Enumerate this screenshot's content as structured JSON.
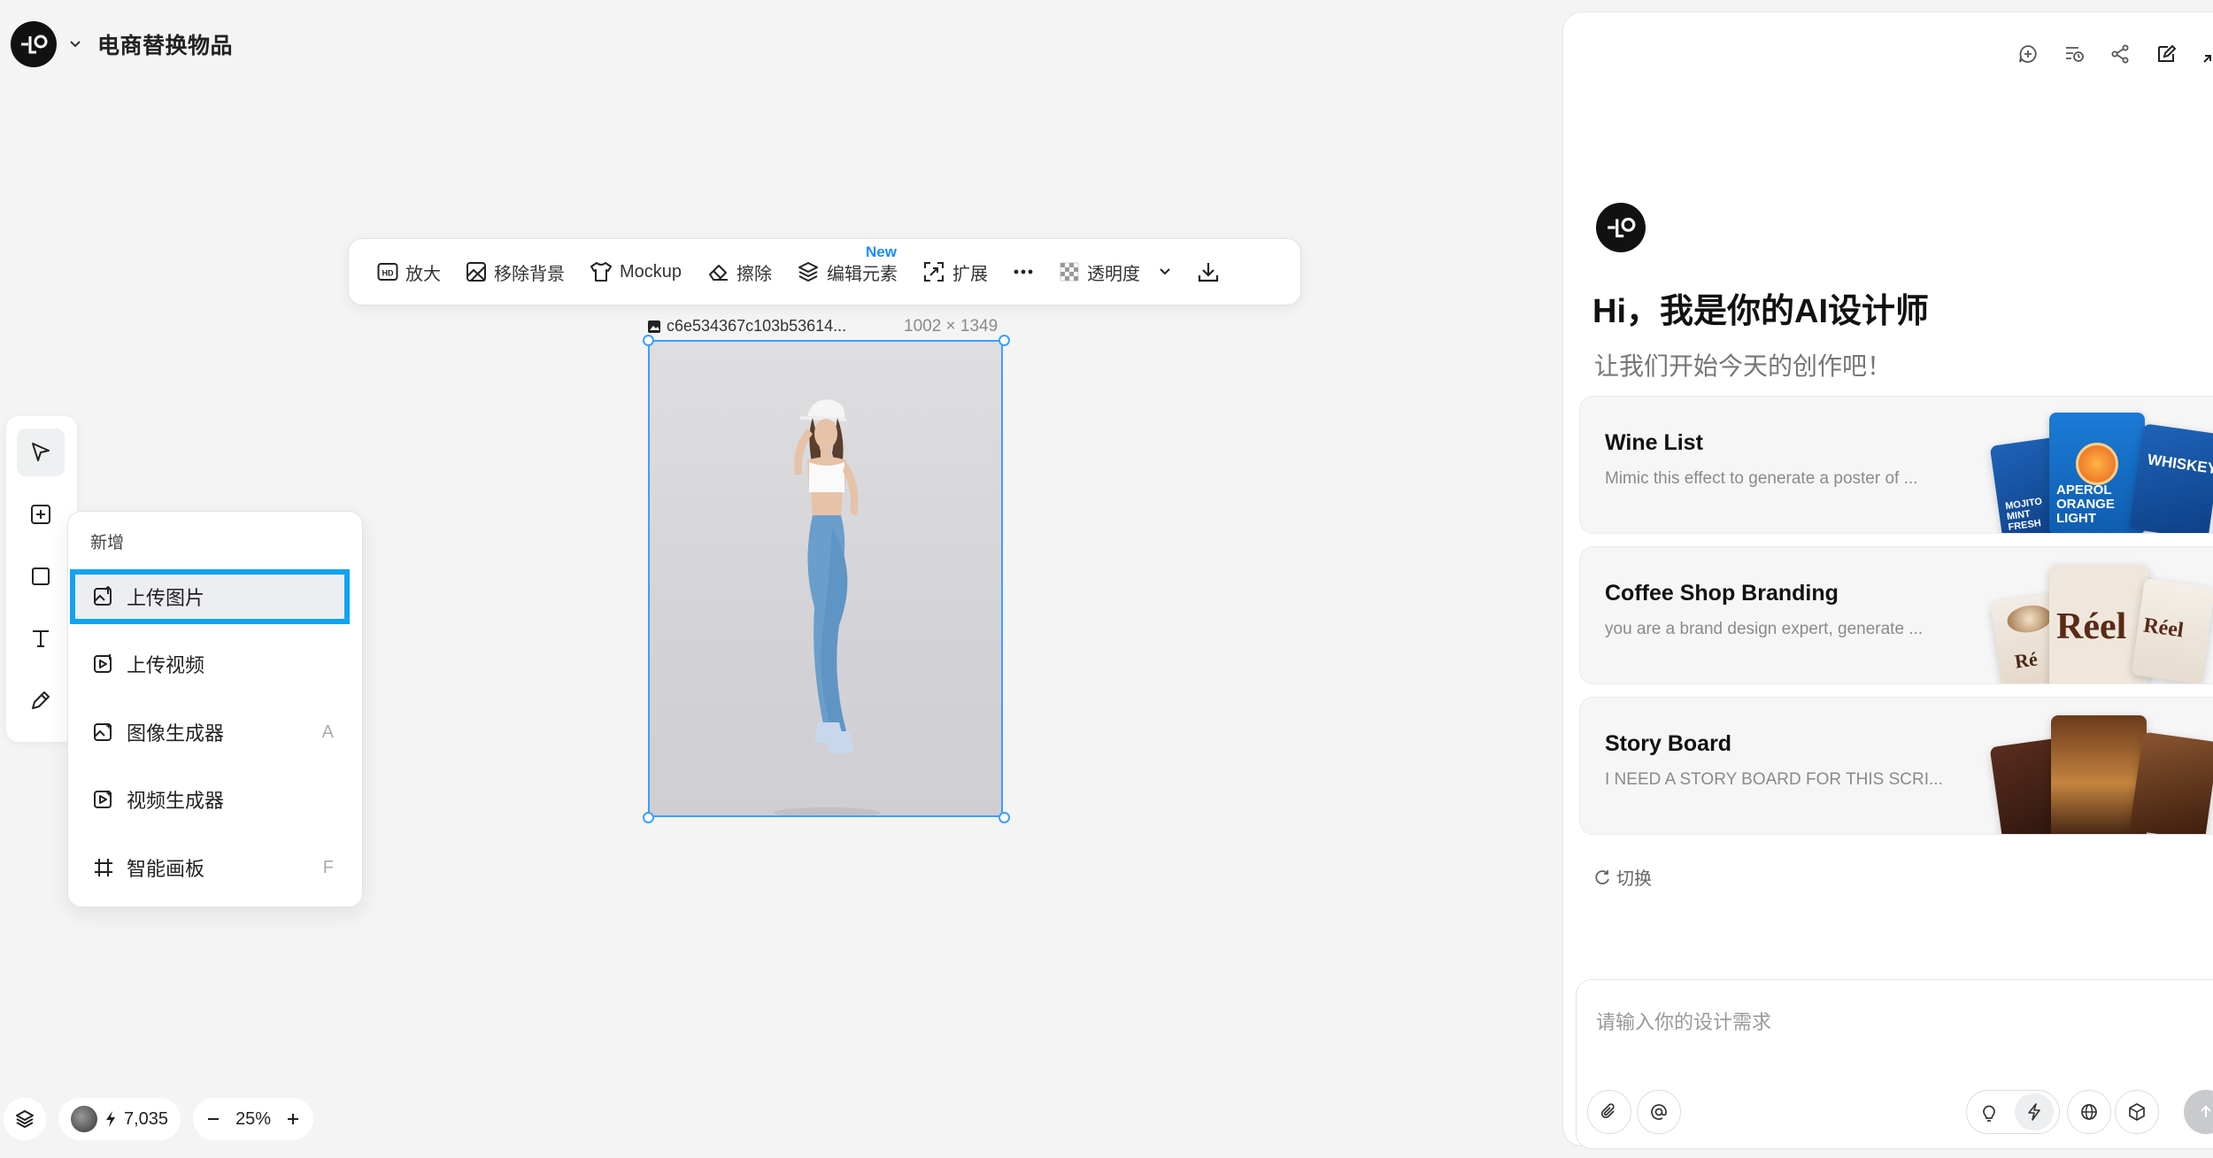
{
  "header": {
    "title": "电商替换物品"
  },
  "toolbar": {
    "items": [
      {
        "label": "放大",
        "icon": "hd-icon"
      },
      {
        "label": "移除背景",
        "icon": "remove-bg-icon"
      },
      {
        "label": "Mockup",
        "icon": "tshirt-icon"
      },
      {
        "label": "擦除",
        "icon": "eraser-icon"
      },
      {
        "label": "编辑元素",
        "icon": "layers-icon",
        "badge": "New"
      },
      {
        "label": "扩展",
        "icon": "expand-icon"
      },
      {
        "label": "透明度",
        "icon": "checker-icon"
      }
    ],
    "more_icon": "more-icon",
    "download_icon": "download-icon"
  },
  "canvas_image": {
    "filename": "c6e534367c103b53614...",
    "dimensions": "1002 × 1349"
  },
  "add_menu": {
    "title": "新增",
    "items": [
      {
        "label": "上传图片",
        "shortcut": ""
      },
      {
        "label": "上传视频",
        "shortcut": ""
      },
      {
        "label": "图像生成器",
        "shortcut": "A"
      },
      {
        "label": "视频生成器",
        "shortcut": ""
      },
      {
        "label": "智能画板",
        "shortcut": "F"
      }
    ]
  },
  "status": {
    "credits": "7,035",
    "zoom": "25%"
  },
  "panel": {
    "greeting": "Hi，我是你的AI设计师",
    "subtitle": "让我们开始今天的创作吧！",
    "cards": [
      {
        "title": "Wine List",
        "desc": "Mimic this effect to generate a poster of ..."
      },
      {
        "title": "Coffee Shop Branding",
        "desc": "you are a brand design expert, generate ..."
      },
      {
        "title": "Story Board",
        "desc": "I NEED A STORY BOARD FOR THIS SCRI..."
      }
    ],
    "switch_label": "切换",
    "input_placeholder": "请输入你的设计需求",
    "thumb_text": {
      "mojito": "MOJITO MINT FRESH",
      "aperol": "APEROL ORANGE LIGHT",
      "whiskey": "WHISKEY",
      "reel": "Réel",
      "reel_short": "Ré"
    }
  },
  "colors": {
    "selection": "#3aa0ff",
    "menu_highlight": "#10a3f2",
    "badge": "#1a8dff"
  }
}
